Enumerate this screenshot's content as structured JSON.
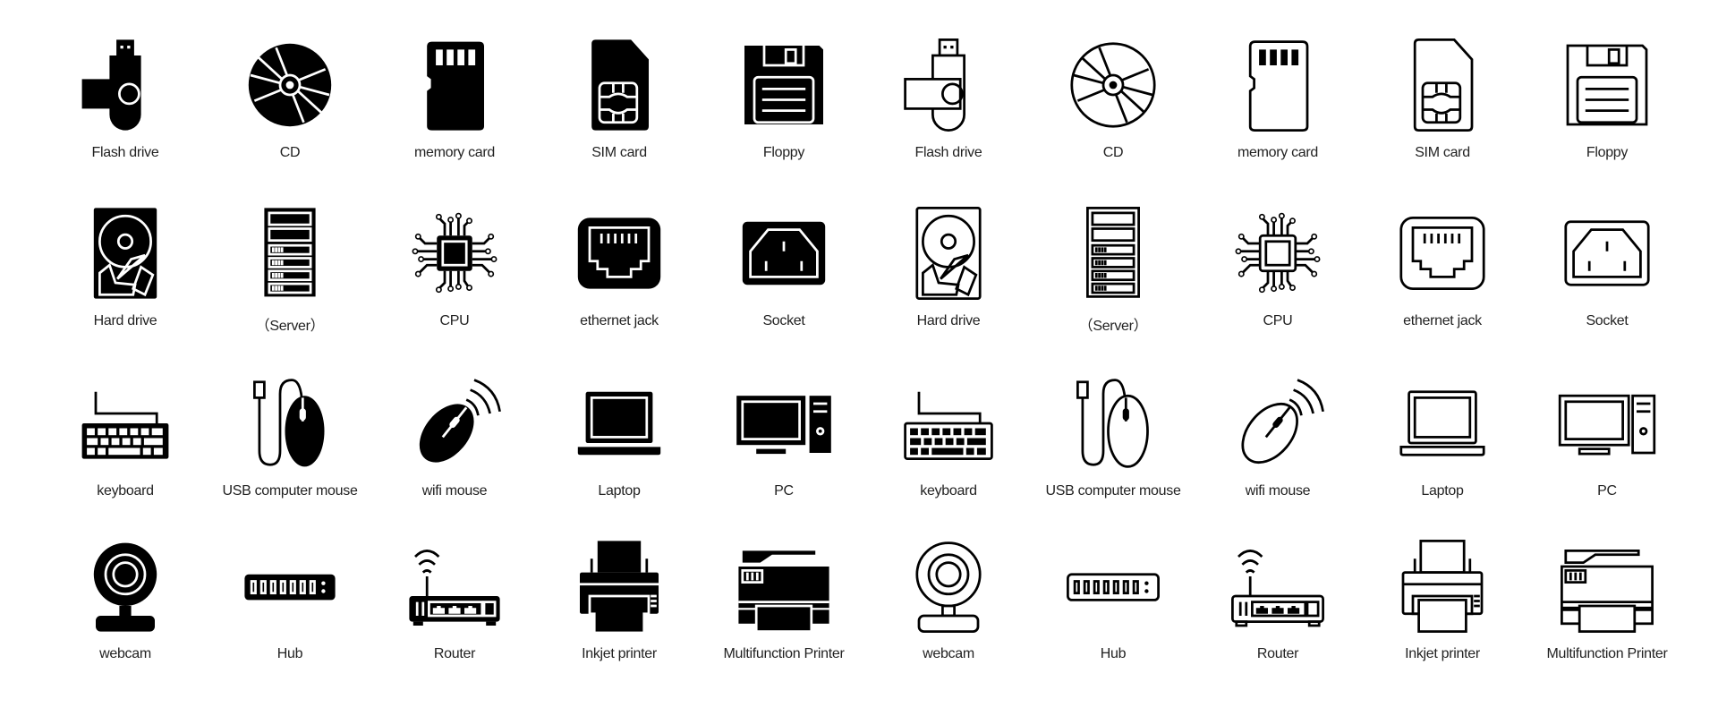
{
  "styles": [
    "filled",
    "outline"
  ],
  "rows": [
    [
      {
        "label": "Flash drive",
        "icon": "flash-drive"
      },
      {
        "label": "CD",
        "icon": "cd"
      },
      {
        "label": "memory card",
        "icon": "memory-card"
      },
      {
        "label": "SIM card",
        "icon": "sim-card"
      },
      {
        "label": "Floppy",
        "icon": "floppy"
      }
    ],
    [
      {
        "label": "Hard drive",
        "icon": "hard-drive"
      },
      {
        "label": "（Server）",
        "icon": "server"
      },
      {
        "label": "CPU",
        "icon": "cpu"
      },
      {
        "label": "ethernet jack",
        "icon": "ethernet-jack"
      },
      {
        "label": "Socket",
        "icon": "socket"
      }
    ],
    [
      {
        "label": "keyboard",
        "icon": "keyboard"
      },
      {
        "label": "USB computer mouse",
        "icon": "usb-mouse"
      },
      {
        "label": "wifi mouse",
        "icon": "wifi-mouse"
      },
      {
        "label": "Laptop",
        "icon": "laptop"
      },
      {
        "label": "PC",
        "icon": "pc"
      }
    ],
    [
      {
        "label": "webcam",
        "icon": "webcam"
      },
      {
        "label": "Hub",
        "icon": "hub"
      },
      {
        "label": "Router",
        "icon": "router"
      },
      {
        "label": "Inkjet printer",
        "icon": "inkjet-printer"
      },
      {
        "label": "Multifunction Printer",
        "icon": "multifunction-printer"
      }
    ]
  ]
}
